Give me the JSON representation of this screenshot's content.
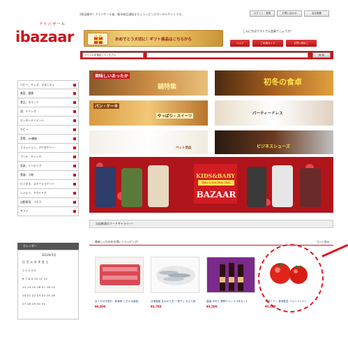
{
  "header": {
    "tagline": "2版混雑中！アイバザール楽、都市商品通販またショッピングポータルサイトです。",
    "top_buttons": [
      "ログイン・登録",
      "お問い合わせ",
      "会社概要"
    ],
    "logo_text": "ibazaar",
    "logo_kana": "アイバザール",
    "promo_text": "おめでとう大切に！ギフト商品はこちらから",
    "member_text": "こんにちはゲストさん会員でしょうか？",
    "red_buttons": [
      "ヘルプ",
      "ご利用ガイド",
      "お買い物かご"
    ]
  },
  "search": {
    "select_value": "ジャンルを指定してください",
    "button_label": "検 索"
  },
  "sidebar": {
    "items": [
      "ベビー、キッズ、マタニティ",
      "美容、健康",
      "食品、スイーツ",
      "酒、ドリンク",
      "エンターテイメント",
      "ホビー",
      "家電、AV機器",
      "ファッション、アクセサリー",
      "フード、ドリンク",
      "家具、インテリア",
      "食器、小物",
      "ビジネス、ステーショナリー",
      "レジャー、アウトドア",
      "自動車用、バイク",
      "ギフト"
    ]
  },
  "calendar": {
    "header": "カレンダー",
    "month": "2012年5月",
    "weekdays": "日 月 火 水 木 金 土",
    "rows": [
      "            1  2  3  4  5",
      " 6  7  8  9 10 11 12",
      "13 14 15 16 17 18 19",
      "20 21 22 23 24 25 26",
      "27 28 29 30 31"
    ]
  },
  "banners": {
    "b1": "美味しいあったか",
    "b1b": "鍋特集",
    "b2": "初冬の食卓",
    "b3": "パン・ケーキ",
    "b3b": "やっぱり・スイーツ",
    "b4": "パーティードレス",
    "b5": "ペット用品",
    "b6": "ビジネスシューズ",
    "kids_line1": "KIDS&BABY",
    "kids_line2": "Baby & Kids Wear Shop",
    "kids_line3": "BAZAAR"
  },
  "featured_bar": "当店推奨のフードギャラリー！",
  "items_bar": "美味しいものをお得にショッピング！",
  "items_more": "もっと見る",
  "products": [
    {
      "desc": "まぐろの中落ち・刺身用 とろける食感",
      "price": "¥4,800"
    },
    {
      "desc": "北海道産 生わかさぎ 一夜干し 天ぷら用",
      "price": "¥3,780"
    },
    {
      "desc": "高級 手作り 黒酢ドリンク 3本セット",
      "price": "¥3,500"
    },
    {
      "desc": "完熟トマト 産地直送 フルーツトマト",
      "price": "¥5,000"
    }
  ]
}
